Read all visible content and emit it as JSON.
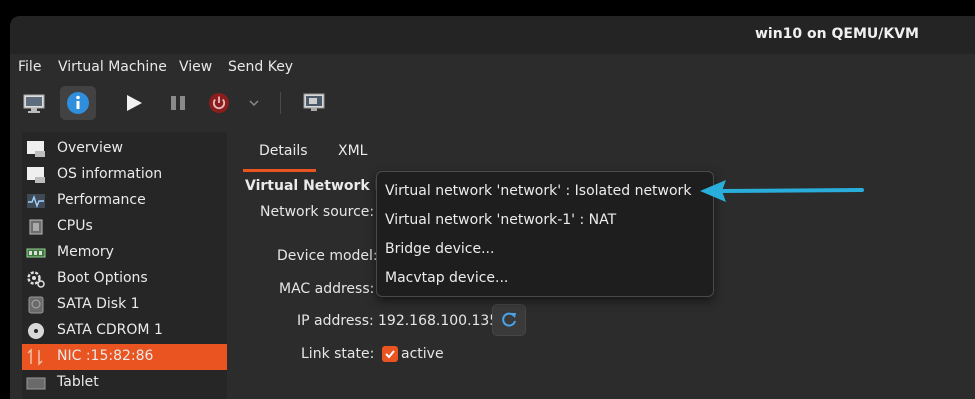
{
  "window": {
    "title": "win10 on QEMU/KVM"
  },
  "menu": [
    "File",
    "Virtual Machine",
    "View",
    "Send Key"
  ],
  "toolbar": {
    "icons": [
      "monitor-icon",
      "info-icon",
      "play-icon",
      "pause-icon",
      "power-icon",
      "chevron-down-icon",
      "screenshot-icon"
    ]
  },
  "sidebar": {
    "items": [
      {
        "label": "Overview",
        "icon": "overview-icon"
      },
      {
        "label": "OS information",
        "icon": "os-info-icon"
      },
      {
        "label": "Performance",
        "icon": "performance-icon"
      },
      {
        "label": "CPUs",
        "icon": "cpu-icon"
      },
      {
        "label": "Memory",
        "icon": "memory-icon"
      },
      {
        "label": "Boot Options",
        "icon": "gear-icon"
      },
      {
        "label": "SATA Disk 1",
        "icon": "disk-icon"
      },
      {
        "label": "SATA CDROM 1",
        "icon": "cdrom-icon"
      },
      {
        "label": "NIC :15:82:86",
        "icon": "nic-icon",
        "selected": true
      },
      {
        "label": "Tablet",
        "icon": "tablet-icon"
      }
    ]
  },
  "tabs": [
    "Details",
    "XML"
  ],
  "details": {
    "section_title": "Virtual Network In",
    "network_source_label": "Network source:",
    "device_model_label": "Device model:",
    "mac_label": "MAC address:",
    "ip_label": "IP address:",
    "ip_value": "192.168.100.135",
    "link_state_label": "Link state:",
    "link_state_value": "active"
  },
  "network_source_menu": [
    "Virtual network 'network' : Isolated network",
    "Virtual network 'network-1' : NAT",
    "Bridge device...",
    "Macvtap device..."
  ],
  "colors": {
    "accent": "#e95420",
    "annotation_arrow": "#29aedc"
  }
}
